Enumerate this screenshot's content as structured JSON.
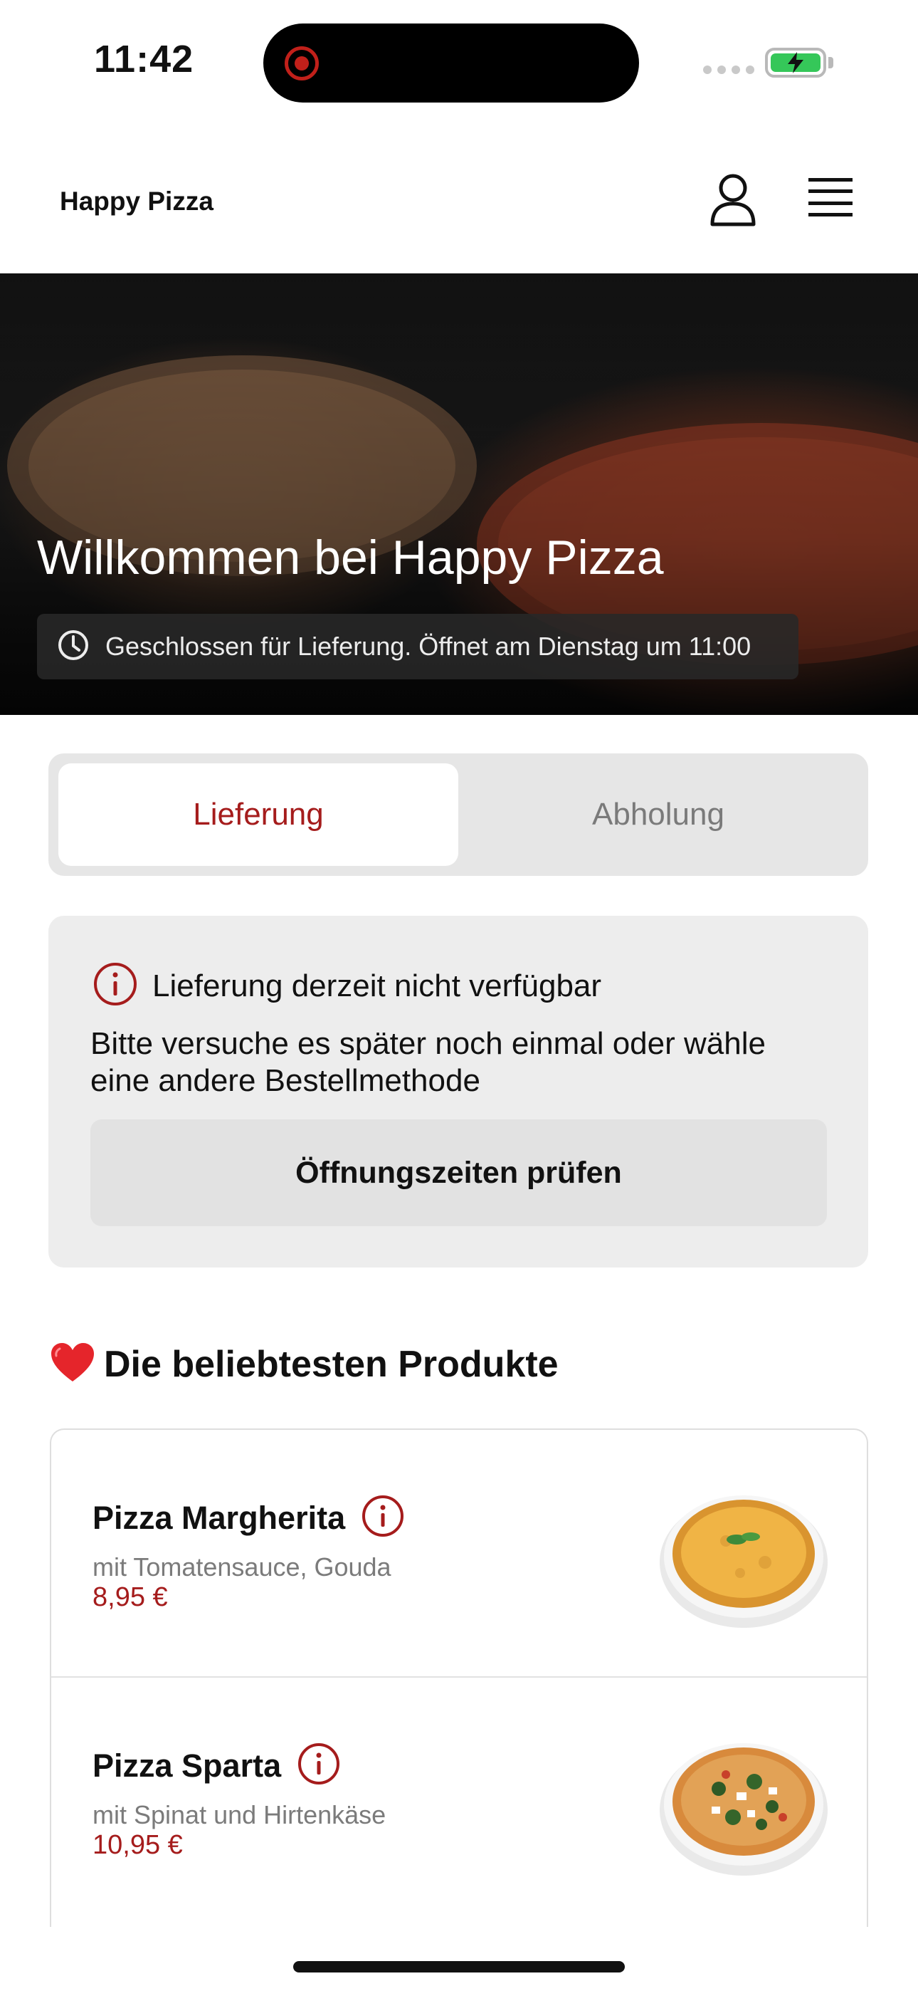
{
  "status_bar": {
    "time": "11:42",
    "battery_color": "#35c759",
    "recording_color": "#c1201a",
    "icons": [
      "recording-icon",
      "signal-icon",
      "battery-charging-icon"
    ]
  },
  "header": {
    "brand": "Happy Pizza",
    "icons": [
      "user-icon",
      "menu-icon"
    ]
  },
  "hero": {
    "title": "Willkommen bei Happy Pizza",
    "status_text": "Geschlossen für Lieferung. Öffnet am Dienstag um 11:00",
    "status_icon": "clock-icon"
  },
  "order_mode": {
    "tabs": [
      {
        "label": "Lieferung",
        "active": true
      },
      {
        "label": "Abholung",
        "active": false
      }
    ]
  },
  "notice": {
    "icon": "info-icon",
    "title": "Lieferung derzeit nicht verfügbar",
    "text": "Bitte versuche es später noch einmal oder wähle eine andere Bestellmethode",
    "button_label": "Öffnungszeiten prüfen"
  },
  "popular": {
    "icon": "heart-icon",
    "title": "Die beliebtesten Produkte",
    "products": [
      {
        "name": "Pizza Margherita",
        "description": "mit Tomatensauce, Gouda",
        "price": "8,95 €",
        "image": "pizza-margherita-image"
      },
      {
        "name": "Pizza Sparta",
        "description": "mit Spinat und Hirtenkäse",
        "price": "10,95 €",
        "image": "pizza-sparta-image"
      }
    ]
  },
  "colors": {
    "accent": "#a51c1c",
    "segment_background": "#e6e6e6",
    "card_background": "#ededed"
  }
}
